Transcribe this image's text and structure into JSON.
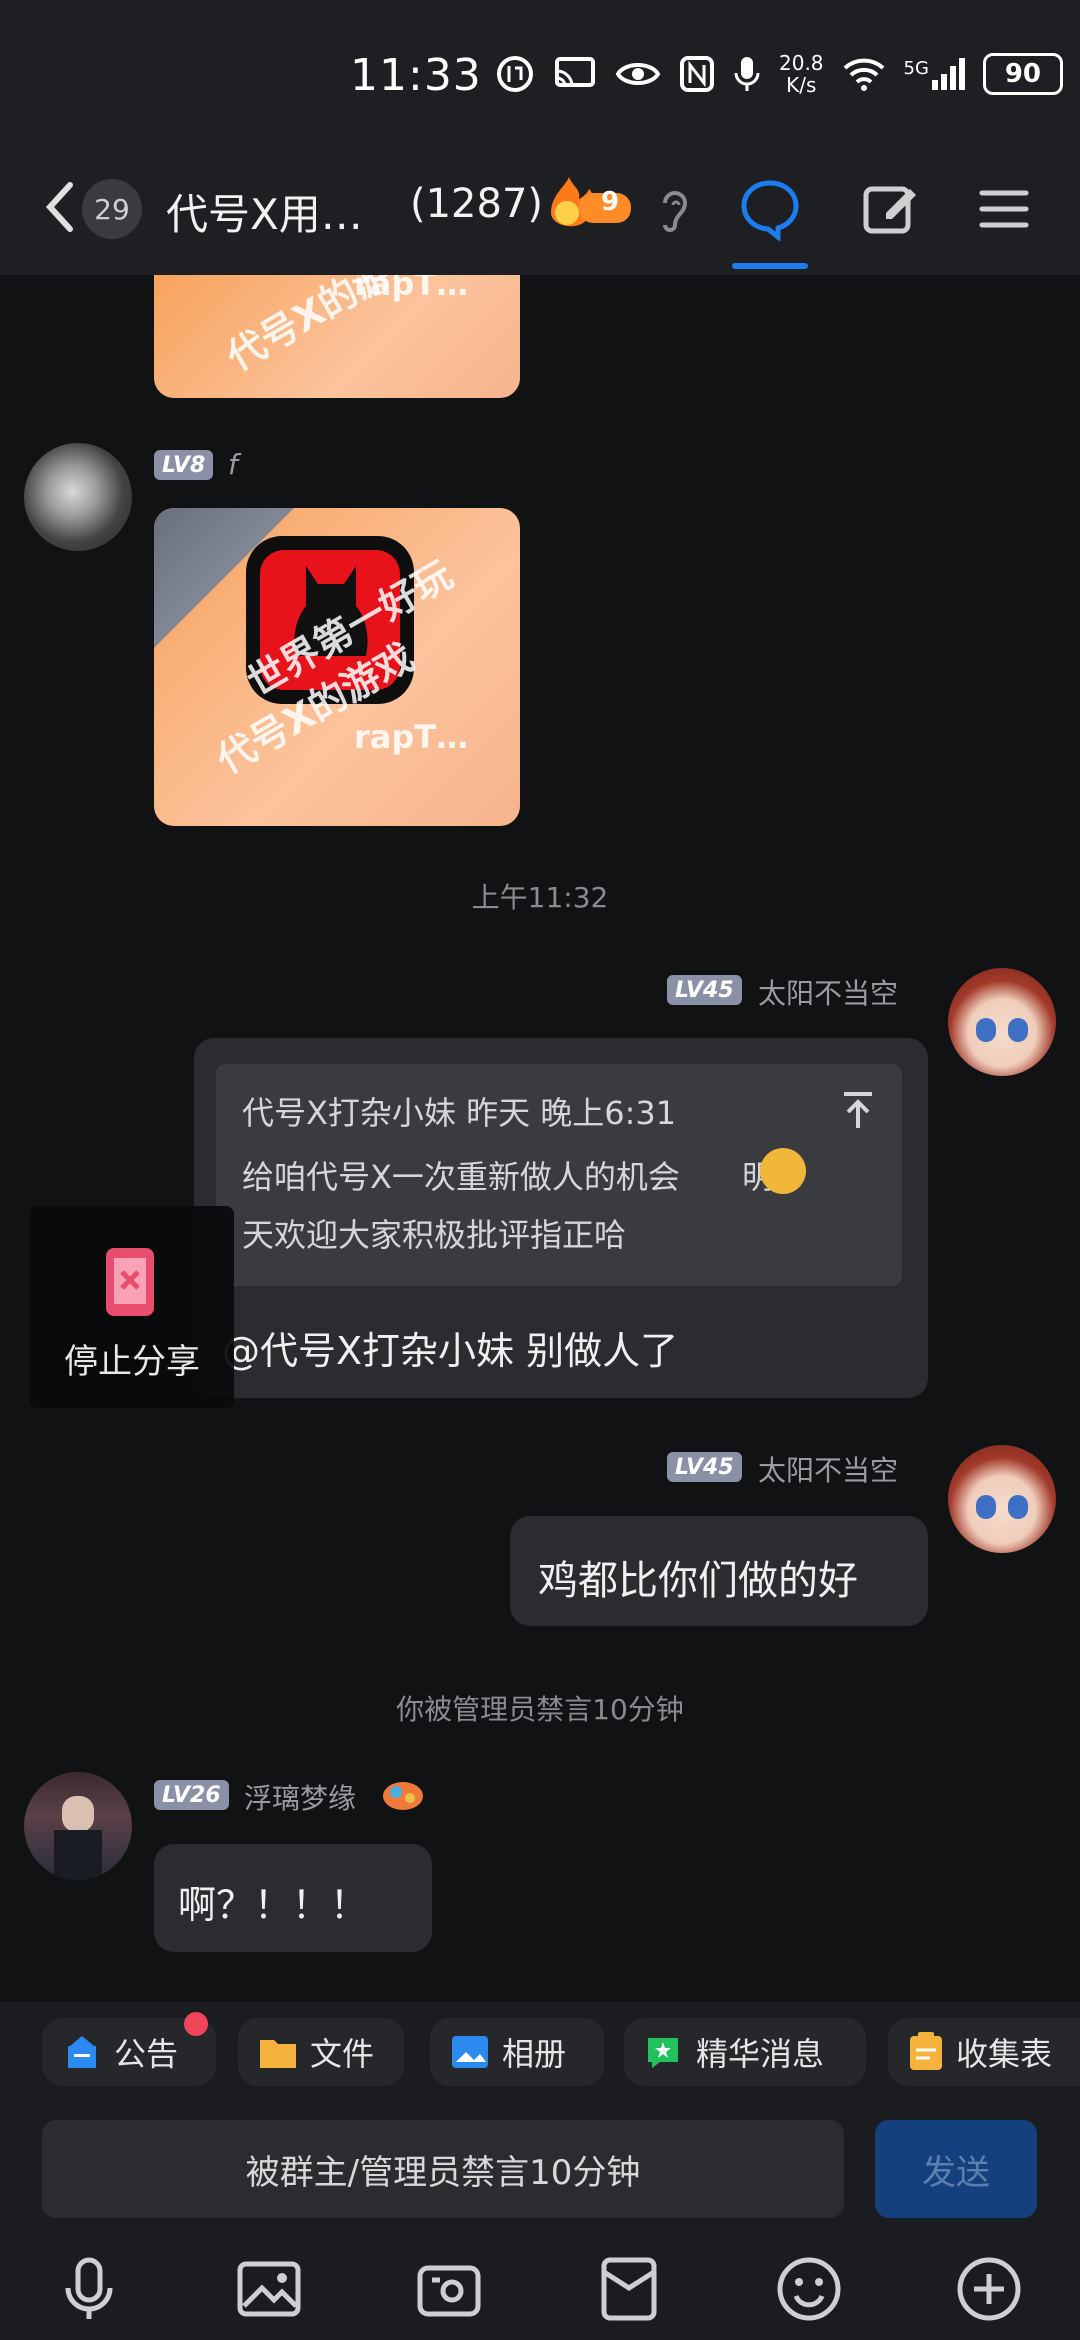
{
  "status_bar": {
    "time": "11:33",
    "net_speed_value": "20.8",
    "net_speed_unit": "K/s",
    "signal_label": "5G",
    "battery": "90"
  },
  "header": {
    "unread_count": "29",
    "group_title": "代号X用…",
    "member_count": "(1287)",
    "fire_level": "9"
  },
  "messages": {
    "sticker_watermark_1": "世界第一好玩",
    "sticker_watermark_2": "代号X的游戏",
    "sticker_watermark_3": "rapT…",
    "user_f_level": "LV8",
    "user_f_name": "f",
    "time_divider": "上午11:32",
    "sender1_level": "LV45",
    "sender1_name": "太阳不当空",
    "quote_header": "代号X打杂小妹 昨天 晚上6:31",
    "quote_line1": "给咱代号X一次重新做人的机会",
    "quote_line1_tail": "明",
    "quote_line2": "天欢迎大家积极批评指正哈",
    "reply_text": "@代号X打杂小妹 别做人了",
    "sender2_level": "LV45",
    "sender2_name": "太阳不当空",
    "msg2_text": "鸡都比你们做的好",
    "system_notice": "你被管理员禁言10分钟",
    "sender3_level": "LV26",
    "sender3_name": "浮璃梦缘",
    "msg3_text": "啊？！！！"
  },
  "overlay": {
    "stop_share_label": "停止分享"
  },
  "chips": [
    {
      "label": "公告",
      "icon": "announcement-icon"
    },
    {
      "label": "文件",
      "icon": "folder-icon"
    },
    {
      "label": "相册",
      "icon": "album-icon"
    },
    {
      "label": "精华消息",
      "icon": "essence-icon"
    },
    {
      "label": "收集表",
      "icon": "clipboard-icon"
    }
  ],
  "input": {
    "muted_text": "被群主/管理员禁言10分钟",
    "send_label": "发送"
  },
  "colors": {
    "accent": "#1c7cf0",
    "background": "#111214",
    "bubble": "#2b2c30"
  }
}
